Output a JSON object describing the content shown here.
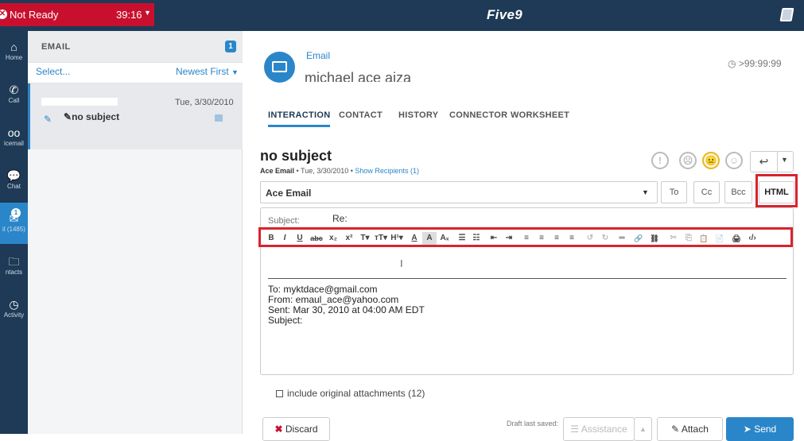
{
  "topbar": {
    "status_label": "Not Ready",
    "status_timer": "39:16",
    "logo": "Five9",
    "book_icon": "book-icon"
  },
  "rail": {
    "items": [
      {
        "label": "Home",
        "icon": "home-icon"
      },
      {
        "label": "Call",
        "icon": "phone-icon"
      },
      {
        "label": "icemail",
        "icon": "voicemail-icon"
      },
      {
        "label": "Chat",
        "icon": "chat-icon"
      },
      {
        "label": "il (1485)",
        "icon": "mail-icon",
        "badge": "1"
      },
      {
        "label": "ntacts",
        "icon": "contacts-icon"
      },
      {
        "label": "Activity",
        "icon": "clock-icon"
      }
    ]
  },
  "email_list": {
    "header": "EMAIL",
    "count": "1",
    "select_label": "Select...",
    "sort_label": "Newest First",
    "items": [
      {
        "date": "Tue, 3/30/2010",
        "subject": "no subject"
      }
    ]
  },
  "interaction": {
    "channel": "Email",
    "contact_name": "michael ace aiza",
    "timer": ">99:99:99",
    "tabs": [
      "INTERACTION",
      "CONTACT",
      "HISTORY",
      "CONNECTOR",
      "WORKSHEET"
    ],
    "subject_title": "no subject",
    "meta_from": "Ace Email",
    "meta_date": "Tue, 3/30/2010",
    "show_recipients": "Show Recipients (1)"
  },
  "compose": {
    "from_value": "Ace Email",
    "to_label": "To",
    "cc_label": "Cc",
    "bcc_label": "Bcc",
    "html_label": "HTML",
    "subject_label": "Subject:",
    "subject_value": "Re:",
    "toolbar": [
      "B",
      "I",
      "U",
      "abc",
      "x₂",
      "x²",
      "T▾",
      "тT▾",
      "H¹▾",
      "A",
      "A",
      "Aₓ",
      "☰",
      "☷",
      "⇤",
      "⇥",
      "≡",
      "≡",
      "≡",
      "≡",
      "↺",
      "↻",
      "═",
      "🔗",
      "⛓",
      "✂",
      "⎘",
      "📋",
      "📄",
      "🖨",
      "‹/›"
    ],
    "quote_to": "To: myktdace@gmail.com",
    "quote_from": "From: emaul_ace@yahoo.com",
    "quote_sent": "Sent: Mar 30, 2010 at 04:00 AM EDT",
    "quote_subject": "Subject:"
  },
  "footer": {
    "include_attachments": "include original attachments (12)",
    "discard": "Discard",
    "draft_saved": "Draft last saved:",
    "assistance": "Assistance",
    "attach": "Attach",
    "send": "Send"
  }
}
